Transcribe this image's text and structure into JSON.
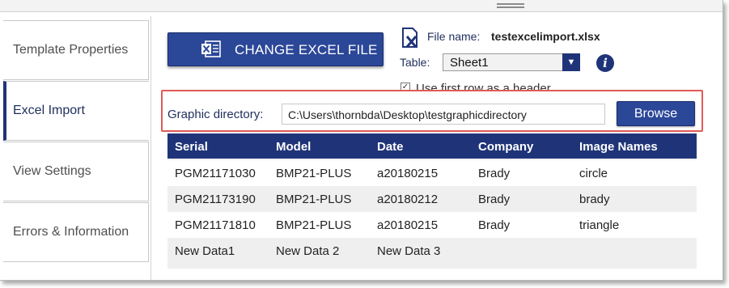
{
  "sidebar": {
    "tabs": [
      {
        "label": "Template Properties"
      },
      {
        "label": "Excel Import"
      },
      {
        "label": "View Settings"
      },
      {
        "label": "Errors & Information"
      }
    ]
  },
  "toolbar": {
    "change_excel_label": "CHANGE EXCEL FILE",
    "file_name_label": "File name:",
    "file_name_value": "testexcelimport.xlsx",
    "table_label": "Table:",
    "table_selected": "Sheet1",
    "use_first_row_label": "Use first row as a header",
    "use_first_row_checked": true
  },
  "graphic_directory": {
    "label": "Graphic directory:",
    "value": "C:\\Users\\thornbda\\Desktop\\testgraphicdirectory",
    "browse_label": "Browse"
  },
  "grid": {
    "columns": [
      "Serial",
      "Model",
      "Date",
      "Company",
      "Image Names"
    ],
    "rows": [
      [
        "PGM21171030",
        "BMP21-PLUS",
        "a20180215",
        "Brady",
        "circle"
      ],
      [
        "PGM21173190",
        "BMP21-PLUS",
        "a20180212",
        "Brady",
        "brady"
      ],
      [
        "PGM21171810",
        "BMP21-PLUS",
        "a20180215",
        "Brady",
        "triangle"
      ],
      [
        "New Data1",
        "New Data 2",
        "New Data 3",
        "",
        ""
      ]
    ]
  },
  "colors": {
    "accent": "#2b4798",
    "header_bg": "#1f3478",
    "highlight_border": "#e05a56"
  }
}
